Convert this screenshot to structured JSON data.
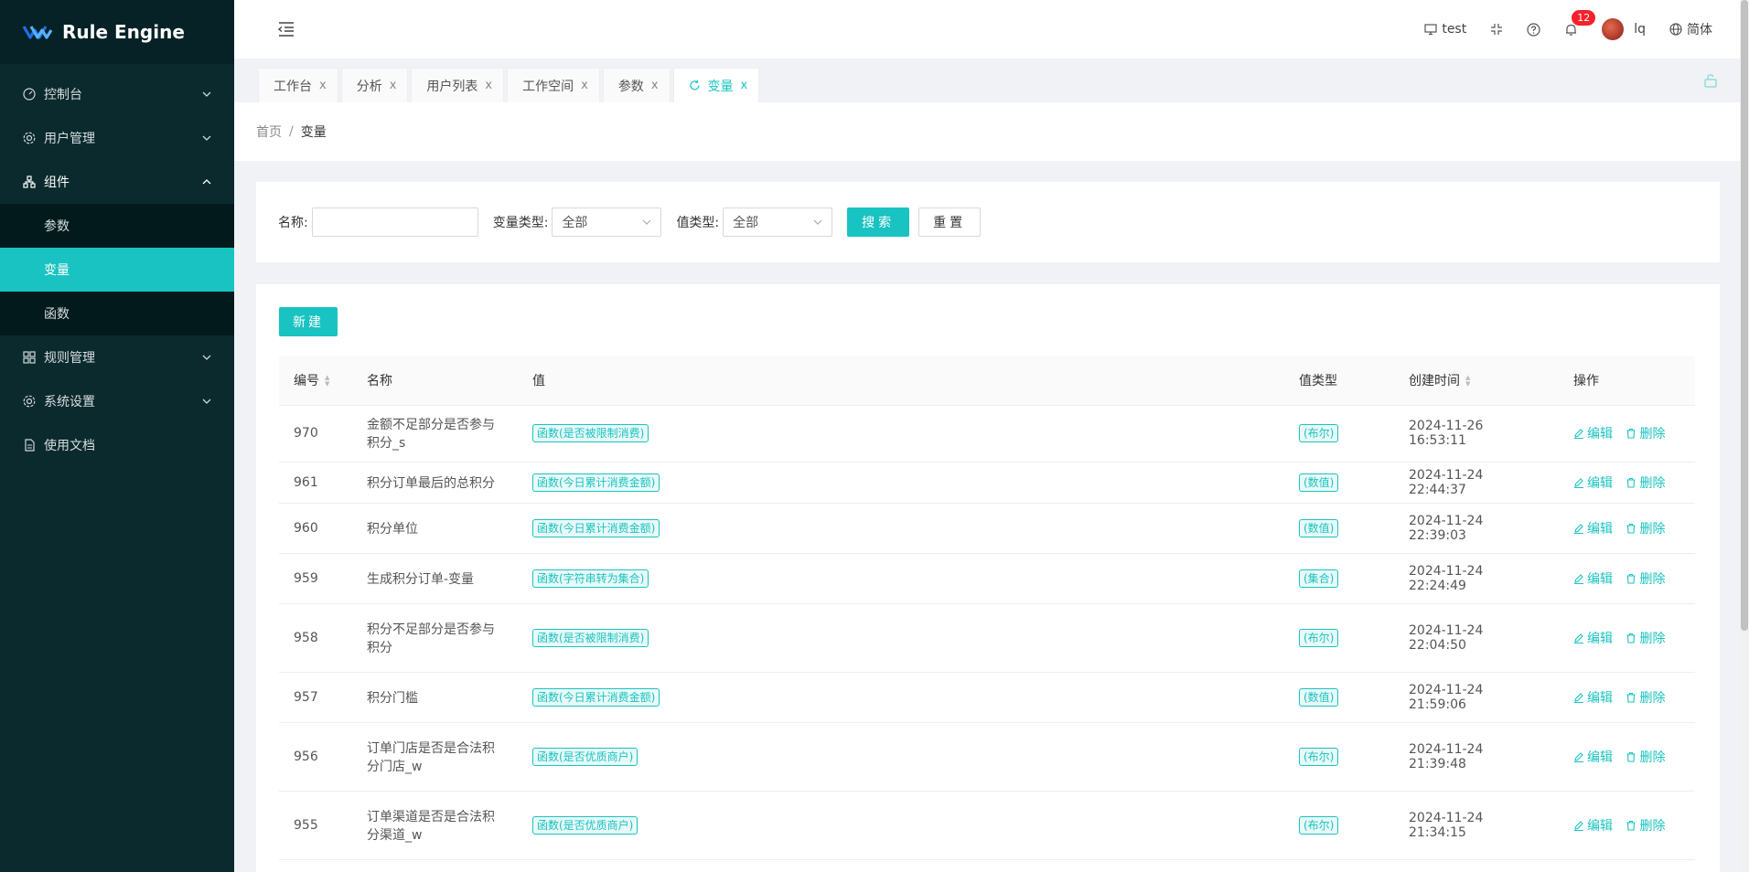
{
  "app": {
    "title": "Rule Engine"
  },
  "colors": {
    "accent": "#19c3c1",
    "sidebar_bg": "#0b2a2e",
    "badge": "#f5222d"
  },
  "sidebar": {
    "items": [
      {
        "label": "控制台",
        "icon": "dashboard-icon",
        "arrow": "chevron-down"
      },
      {
        "label": "用户管理",
        "icon": "gear-icon",
        "arrow": "chevron-down"
      },
      {
        "label": "组件",
        "icon": "cluster-icon",
        "arrow": "chevron-up",
        "open": true,
        "children": [
          {
            "label": "参数"
          },
          {
            "label": "变量",
            "active": true
          },
          {
            "label": "函数"
          }
        ]
      },
      {
        "label": "规则管理",
        "icon": "grid-icon",
        "arrow": "chevron-down"
      },
      {
        "label": "系统设置",
        "icon": "gear-icon",
        "arrow": "chevron-down"
      },
      {
        "label": "使用文档",
        "icon": "document-icon"
      }
    ]
  },
  "header": {
    "env_label": "test",
    "notifications_count": "12",
    "user_name": "lq",
    "language": "简体"
  },
  "tabs": [
    {
      "label": "工作台"
    },
    {
      "label": "分析"
    },
    {
      "label": "用户列表"
    },
    {
      "label": "工作空间"
    },
    {
      "label": "参数"
    },
    {
      "label": "变量",
      "active": true
    }
  ],
  "tab_close": "x",
  "breadcrumb": {
    "home": "首页",
    "sep": "/",
    "current": "变量"
  },
  "search": {
    "name_label": "名称:",
    "name_value": "",
    "var_type_label": "变量类型:",
    "var_type_value": "全部",
    "value_type_label": "值类型:",
    "value_type_value": "全部",
    "search_btn": "搜索",
    "reset_btn": "重置"
  },
  "table": {
    "new_btn": "新建",
    "columns": {
      "id": "编号",
      "name": "名称",
      "value": "值",
      "value_type": "值类型",
      "created": "创建时间",
      "actions": "操作"
    },
    "edit_label": "编辑",
    "delete_label": "删除",
    "rows": [
      {
        "id": "970",
        "name": "金额不足部分是否参与积分_s",
        "value": "函数(是否被限制消费)",
        "value_type": "(布尔)",
        "created": "2024-11-26 16:53:11"
      },
      {
        "id": "961",
        "name": "积分订单最后的总积分",
        "value": "函数(今日累计消费金额)",
        "value_type": "(数值)",
        "created": "2024-11-24 22:44:37"
      },
      {
        "id": "960",
        "name": "积分单位",
        "value": "函数(今日累计消费金额)",
        "value_type": "(数值)",
        "created": "2024-11-24 22:39:03"
      },
      {
        "id": "959",
        "name": "生成积分订单-变量",
        "value": "函数(字符串转为集合)",
        "value_type": "(集合)",
        "created": "2024-11-24 22:24:49"
      },
      {
        "id": "958",
        "name": "积分不足部分是否参与积分",
        "value": "函数(是否被限制消费)",
        "value_type": "(布尔)",
        "created": "2024-11-24 22:04:50"
      },
      {
        "id": "957",
        "name": "积分门槛",
        "value": "函数(今日累计消费金额)",
        "value_type": "(数值)",
        "created": "2024-11-24 21:59:06"
      },
      {
        "id": "956",
        "name": "订单门店是否是合法积分门店_w",
        "value": "函数(是否优质商户)",
        "value_type": "(布尔)",
        "created": "2024-11-24 21:39:48"
      },
      {
        "id": "955",
        "name": "订单渠道是否是合法积分渠道_w",
        "value": "函数(是否优质商户)",
        "value_type": "(布尔)",
        "created": "2024-11-24 21:34:15"
      }
    ]
  }
}
